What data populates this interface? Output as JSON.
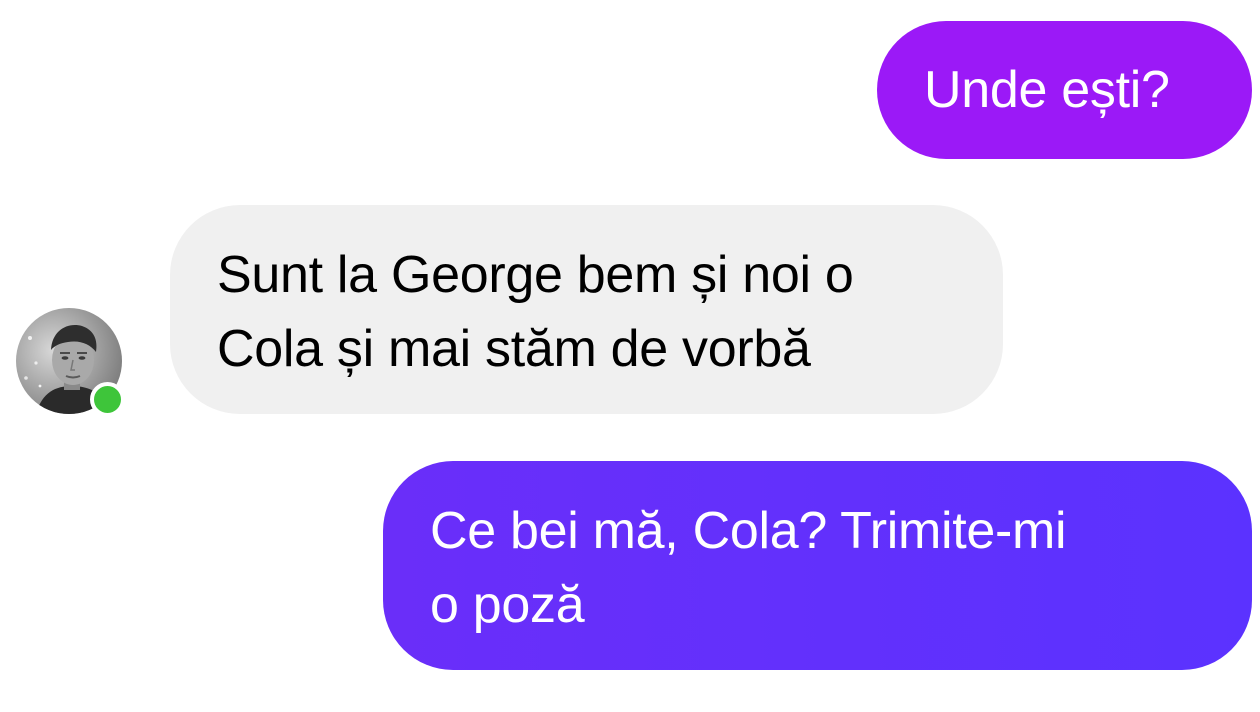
{
  "colors": {
    "outgoing_top": "#9b19f7",
    "outgoing_bottom": "#5b32ff",
    "incoming": "#f0f0f0",
    "online": "#3ec53a"
  },
  "messages": [
    {
      "sender": "me",
      "lines": [
        "Unde ești?"
      ]
    },
    {
      "sender": "contact",
      "lines": [
        "Sunt la George bem și noi o",
        "Cola și mai stăm de vorbă"
      ]
    },
    {
      "sender": "me",
      "lines": [
        "Ce bei mă, Cola? Trimite-mi",
        "o poză"
      ]
    }
  ],
  "contact": {
    "avatar_icon": "user-photo-icon",
    "status_icon": "online-indicator-icon"
  }
}
